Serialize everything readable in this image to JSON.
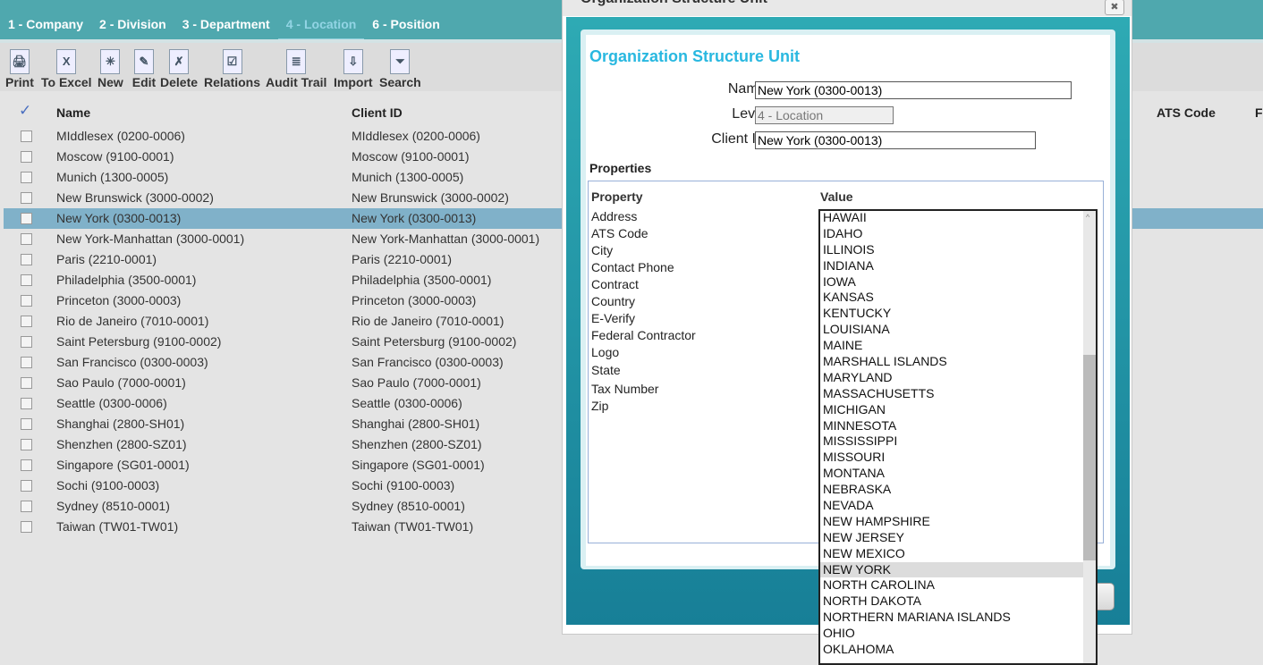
{
  "tabs": [
    {
      "label": "1 - Company"
    },
    {
      "label": "2 - Division"
    },
    {
      "label": "3 - Department"
    },
    {
      "label": "4 - Location",
      "active": true
    },
    {
      "label": "6 - Position"
    }
  ],
  "toolbar": [
    {
      "label": "Print",
      "icon": "printer-icon"
    },
    {
      "label": "To Excel",
      "icon": "excel-icon"
    },
    {
      "label": "New",
      "icon": "new-document-icon"
    },
    {
      "label": "Edit",
      "icon": "edit-icon"
    },
    {
      "label": "Delete",
      "icon": "delete-icon"
    },
    {
      "label": "Relations",
      "icon": "relations-icon"
    },
    {
      "label": "Audit Trail",
      "icon": "audit-trail-icon"
    },
    {
      "label": "Import",
      "icon": "import-icon"
    },
    {
      "label": "Search",
      "icon": "search-filter-icon"
    }
  ],
  "grid": {
    "headers": {
      "name": "Name",
      "client_id": "Client ID",
      "ats": "ATS Code",
      "f": "F"
    },
    "rows": [
      [
        "MIddlesex (0200-0006)",
        "MIddlesex (0200-0006)"
      ],
      [
        "Moscow (9100-0001)",
        "Moscow (9100-0001)"
      ],
      [
        "Munich (1300-0005)",
        "Munich (1300-0005)"
      ],
      [
        "New Brunswick (3000-0002)",
        "New Brunswick (3000-0002)"
      ],
      [
        "New York (0300-0013)",
        "New York (0300-0013)"
      ],
      [
        "New York-Manhattan (3000-0001)",
        "New York-Manhattan (3000-0001)"
      ],
      [
        "Paris (2210-0001)",
        "Paris (2210-0001)"
      ],
      [
        "Philadelphia (3500-0001)",
        "Philadelphia (3500-0001)"
      ],
      [
        "Princeton (3000-0003)",
        "Princeton (3000-0003)"
      ],
      [
        "Rio de Janeiro (7010-0001)",
        "Rio de Janeiro (7010-0001)"
      ],
      [
        "Saint Petersburg (9100-0002)",
        "Saint Petersburg (9100-0002)"
      ],
      [
        "San Francisco (0300-0003)",
        "San Francisco (0300-0003)"
      ],
      [
        "Sao Paulo (7000-0001)",
        "Sao Paulo (7000-0001)"
      ],
      [
        "Seattle (0300-0006)",
        "Seattle (0300-0006)"
      ],
      [
        "Shanghai (2800-SH01)",
        "Shanghai (2800-SH01)"
      ],
      [
        "Shenzhen (2800-SZ01)",
        "Shenzhen (2800-SZ01)"
      ],
      [
        "Singapore (SG01-0001)",
        "Singapore (SG01-0001)"
      ],
      [
        "Sochi (9100-0003)",
        "Sochi (9100-0003)"
      ],
      [
        "Sydney (8510-0001)",
        "Sydney (8510-0001)"
      ],
      [
        "Taiwan (TW01-TW01)",
        "Taiwan (TW01-TW01)"
      ]
    ],
    "selected_index": 4
  },
  "dialog": {
    "window_title": "Organization Structure Unit",
    "title": "Organization Structure Unit",
    "name_label": "Name:",
    "name_value": "New York (0300-0013)",
    "level_label": "Level:",
    "level_value": "4 - Location",
    "client_label": "Client ID:",
    "client_value": "New York (0300-0013)",
    "properties_label": "Properties",
    "property_header": "Property",
    "value_header": "Value",
    "properties": [
      "Address",
      "ATS Code",
      "City",
      "Contact Phone",
      "Contract",
      "Country",
      "E-Verify",
      "Federal Contractor",
      "Logo",
      "State",
      "Tax Number",
      "Zip"
    ]
  },
  "dropdown": {
    "options": [
      "HAWAII",
      "IDAHO",
      "ILLINOIS",
      "INDIANA",
      "IOWA",
      "KANSAS",
      "KENTUCKY",
      "LOUISIANA",
      "MAINE",
      "MARSHALL ISLANDS",
      "MARYLAND",
      "MASSACHUSETTS",
      "MICHIGAN",
      "MINNESOTA",
      "MISSISSIPPI",
      "MISSOURI",
      "MONTANA",
      "NEBRASKA",
      "NEVADA",
      "NEW HAMPSHIRE",
      "NEW JERSEY",
      "NEW MEXICO",
      "NEW YORK",
      "NORTH CAROLINA",
      "NORTH DAKOTA",
      "NORTHERN MARIANA ISLANDS",
      "OHIO",
      "OKLAHOMA"
    ],
    "selected": "NEW YORK"
  },
  "colors": {
    "teal": "#4fa8ae",
    "accent_title": "#29b8e0",
    "selected_row": "#80b1c9"
  }
}
